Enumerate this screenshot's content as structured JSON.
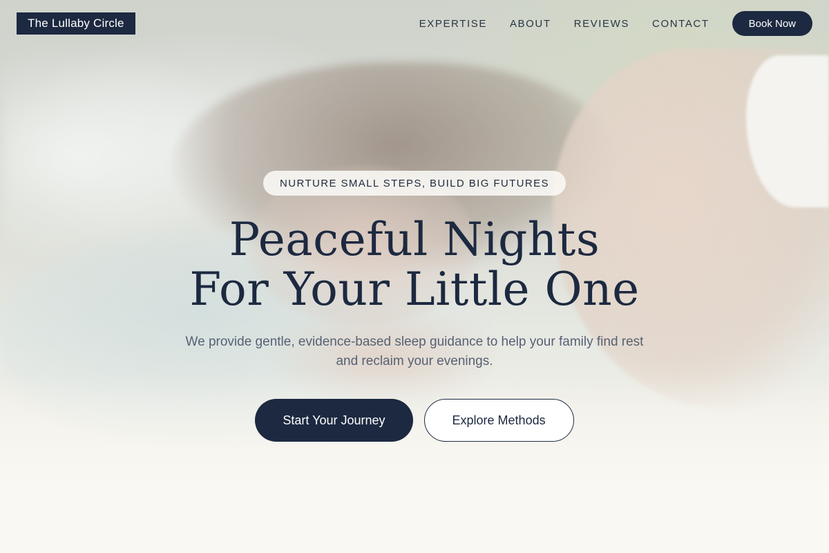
{
  "header": {
    "brand": "The Lullaby Circle",
    "nav": [
      {
        "label": "EXPERTISE"
      },
      {
        "label": "ABOUT"
      },
      {
        "label": "REVIEWS"
      },
      {
        "label": "CONTACT"
      }
    ],
    "cta": "Book Now"
  },
  "hero": {
    "eyebrow": "NURTURE SMALL STEPS, BUILD BIG FUTURES",
    "headline_line1": "Peaceful Nights",
    "headline_line2": "For Your Little One",
    "subtitle": "We provide gentle, evidence-based sleep guidance to help your family find rest and reclaim your evenings.",
    "primary_cta": "Start Your Journey",
    "secondary_cta": "Explore Methods"
  },
  "colors": {
    "navy": "#1c2940",
    "subtitle_gray": "#566173",
    "cream": "#faf8f2"
  }
}
